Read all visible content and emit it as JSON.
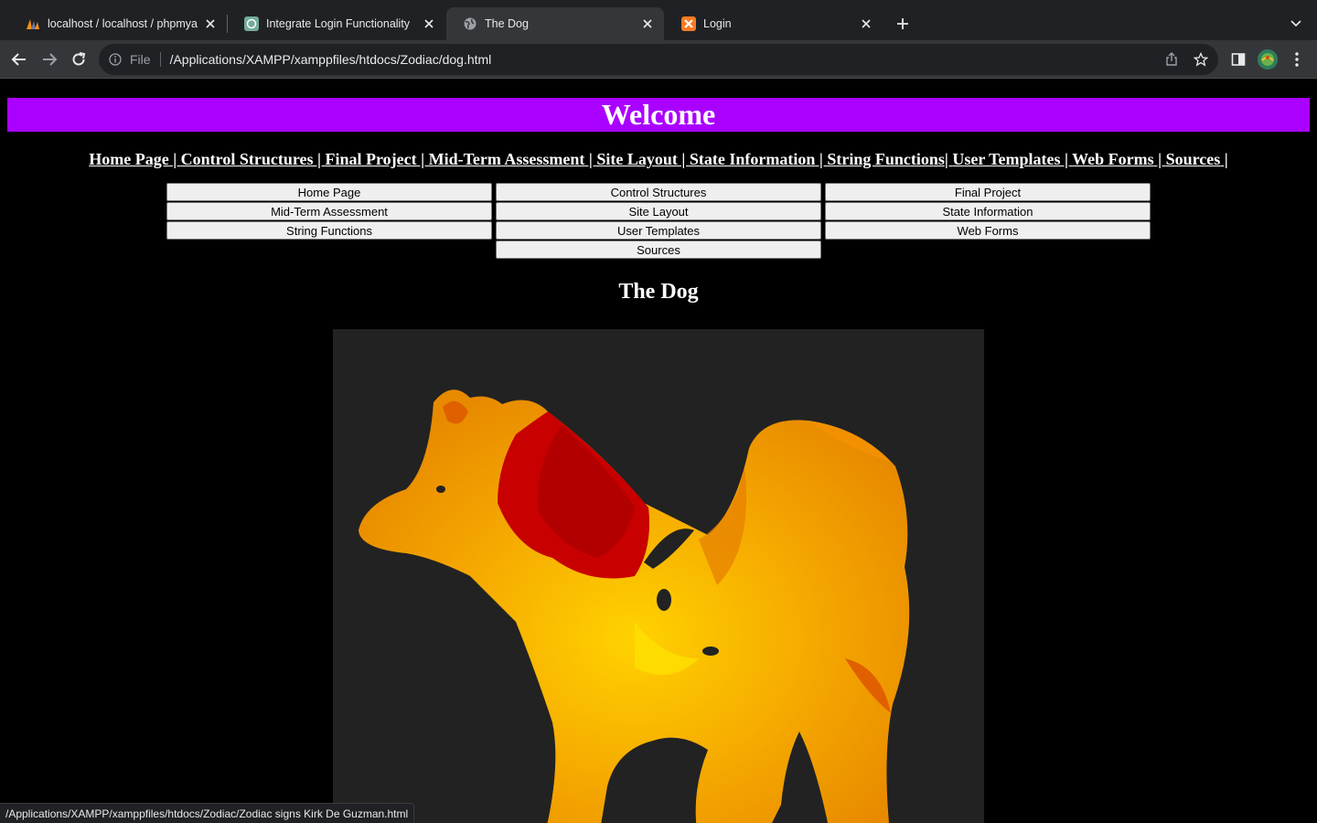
{
  "browser": {
    "tabs": [
      {
        "title": "localhost / localhost / phpmyadmin",
        "icon": "phpmyadmin-icon",
        "active": false
      },
      {
        "title": "Integrate Login Functionality",
        "icon": "chatgpt-icon",
        "active": false
      },
      {
        "title": "The Dog",
        "icon": "globe-icon",
        "active": true
      },
      {
        "title": "Login",
        "icon": "xampp-icon",
        "active": false
      }
    ],
    "address": {
      "scheme": "File",
      "url": "/Applications/XAMPP/xamppfiles/htdocs/Zodiac/dog.html"
    },
    "status_url": "/Applications/XAMPP/xamppfiles/htdocs/Zodiac/Zodiac signs Kirk De Guzman.html"
  },
  "page": {
    "banner_title": "Welcome",
    "banner_color": "#aa00ff",
    "text_nav": [
      {
        "label": "Home Page",
        "sep": " | "
      },
      {
        "label": "Control Structures",
        "sep": " | "
      },
      {
        "label": "Final Project",
        "sep": " | "
      },
      {
        "label": "Mid-Term Assessment",
        "sep": " | "
      },
      {
        "label": "Site Layout",
        "sep": " | "
      },
      {
        "label": "State Information",
        "sep": " | "
      },
      {
        "label": "String Functions",
        "sep": "| "
      },
      {
        "label": "User Templates",
        "sep": " | "
      },
      {
        "label": "Web Forms",
        "sep": " | "
      },
      {
        "label": "Sources",
        "sep": " |"
      }
    ],
    "buttons": [
      "Home Page",
      "Control Structures",
      "Final Project",
      "Mid-Term Assessment",
      "Site Layout",
      "State Information",
      "String Functions",
      "User Templates",
      "Web Forms",
      "",
      "Sources",
      ""
    ],
    "heading": "The Dog",
    "image": {
      "subject": "dog-zodiac-image",
      "colors": [
        "#f5a800",
        "#e06000",
        "#c00000",
        "#ffd200"
      ]
    }
  }
}
